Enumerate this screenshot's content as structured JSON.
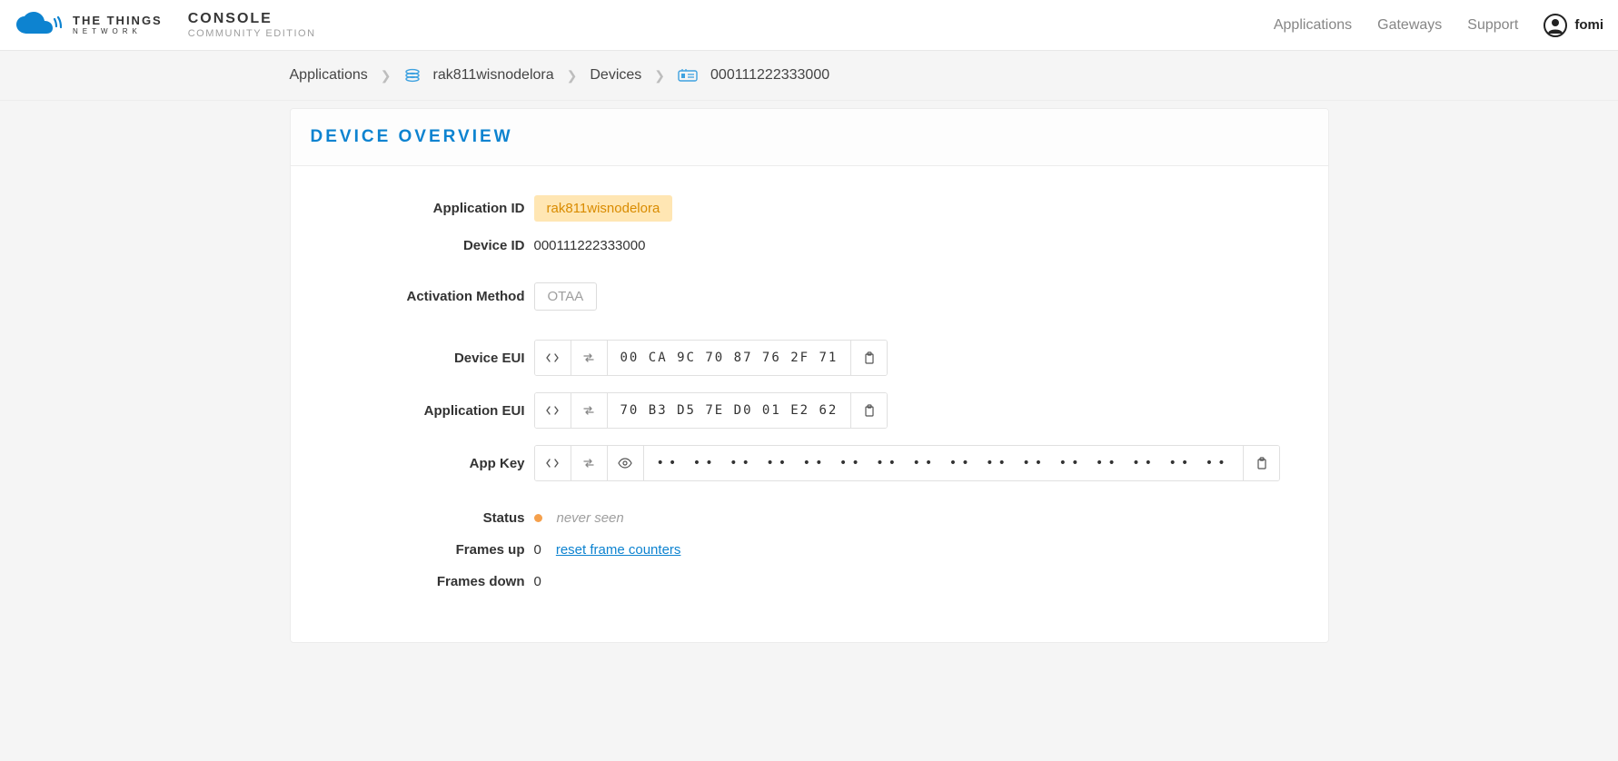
{
  "header": {
    "brand_top": "THE THINGS",
    "brand_bottom": "NETWORK",
    "console": "CONSOLE",
    "community": "COMMUNITY EDITION",
    "nav": {
      "applications": "Applications",
      "gateways": "Gateways",
      "support": "Support"
    },
    "username": "fomi"
  },
  "breadcrumb": {
    "applications": "Applications",
    "app_id": "rak811wisnodelora",
    "devices": "Devices",
    "device_id": "000111222333000"
  },
  "panel": {
    "title": "DEVICE OVERVIEW"
  },
  "fields": {
    "application_id_label": "Application ID",
    "application_id_value": "rak811wisnodelora",
    "device_id_label": "Device ID",
    "device_id_value": "000111222333000",
    "activation_method_label": "Activation Method",
    "activation_method_value": "OTAA",
    "device_eui_label": "Device EUI",
    "device_eui_value": "00 CA 9C 70 87 76 2F 71",
    "application_eui_label": "Application EUI",
    "application_eui_value": "70 B3 D5 7E D0 01 E2 62",
    "app_key_label": "App Key",
    "app_key_masked": "•• •• •• •• •• •• •• •• •• •• •• •• •• •• •• ••",
    "status_label": "Status",
    "status_value": "never seen",
    "frames_up_label": "Frames up",
    "frames_up_value": "0",
    "reset_counters": "reset frame counters",
    "frames_down_label": "Frames down",
    "frames_down_value": "0"
  }
}
